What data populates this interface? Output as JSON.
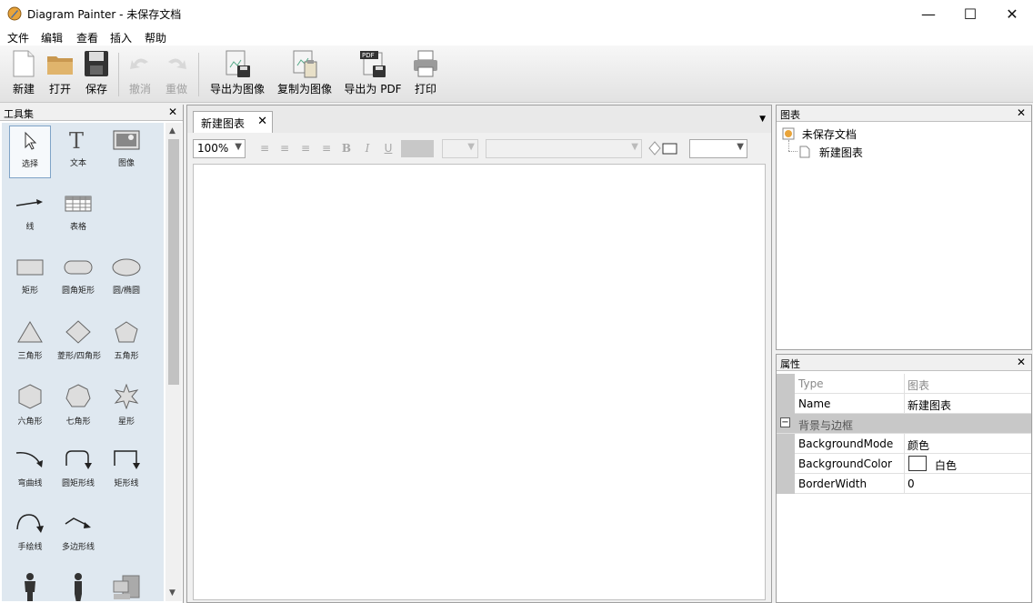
{
  "window": {
    "title": "Diagram Painter - 未保存文档",
    "minimize": "—",
    "maximize": "☐",
    "close": "✕"
  },
  "menu": [
    "文件",
    "编辑",
    "查看",
    "插入",
    "帮助"
  ],
  "toolbar": {
    "new": "新建",
    "open": "打开",
    "save": "保存",
    "undo": "撤消",
    "redo": "重做",
    "export_image": "导出为图像",
    "copy_image": "复制为图像",
    "export_pdf": "导出为 PDF",
    "print": "打印"
  },
  "toolbox": {
    "title": "工具集",
    "tools": [
      "选择",
      "文本",
      "图像",
      "线",
      "表格",
      "矩形",
      "圆角矩形",
      "圆/椭圆",
      "三角形",
      "菱形/四角形",
      "五角形",
      "六角形",
      "七角形",
      "星形",
      "弯曲线",
      "圆矩形线",
      "矩形线",
      "手绘线",
      "多边形线"
    ]
  },
  "document": {
    "tab": "新建图表",
    "zoom": "100%"
  },
  "tree": {
    "title": "图表",
    "root": "未保存文档",
    "child": "新建图表"
  },
  "props": {
    "title": "属性",
    "rows": [
      {
        "key": "Type",
        "value": "图表"
      },
      {
        "key": "Name",
        "value": "新建图表"
      }
    ],
    "category": "背景与边框",
    "cat_rows": [
      {
        "key": "BackgroundMode",
        "value": "颜色"
      },
      {
        "key": "BackgroundColor",
        "value": "白色"
      },
      {
        "key": "BorderWidth",
        "value": "0"
      }
    ]
  }
}
